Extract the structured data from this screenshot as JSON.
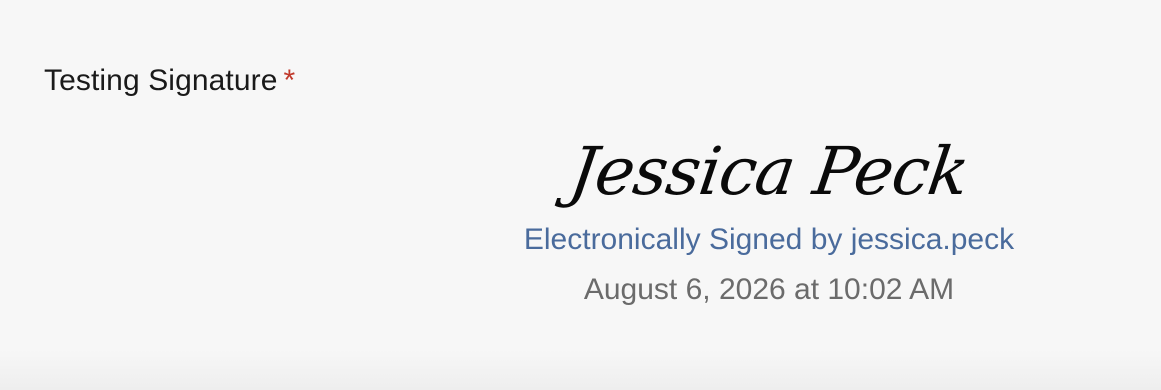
{
  "field": {
    "label": "Testing Signature",
    "required_mark": "*"
  },
  "signature": {
    "name": "Jessica Peck",
    "signed_by_text": "Electronically Signed by jessica.peck",
    "signed_date": "August 6, 2026 at 10:02 AM"
  },
  "colors": {
    "background": "#f7f7f7",
    "label": "#1a1a1a",
    "required": "#c0392b",
    "signed_by": "#4a6b9c",
    "date": "#6b6b6b"
  }
}
